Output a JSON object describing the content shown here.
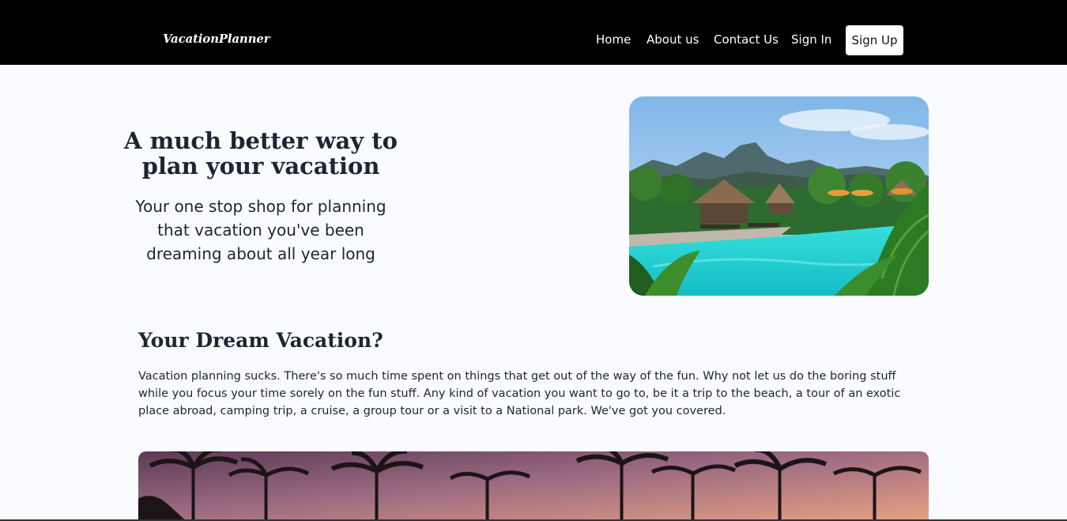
{
  "nav": {
    "brand": "VacationPlanner",
    "links": [
      "Home",
      "About us",
      "Contact Us",
      "Sign In"
    ],
    "signup_label": "Sign Up"
  },
  "hero": {
    "title": "A much better way to plan your vacation",
    "subtitle": "Your one stop shop for planning that vacation you've been dreaming about all year long",
    "image": "tropical-resort-pool-photo"
  },
  "dream": {
    "heading": "Your Dream Vacation?",
    "body": "Vacation planning sucks. There's so much time spent on things that get out of the way of the fun. Why not let us do the boring stuff while you focus your time sorely on the fun stuff. Any kind of vacation you want to go to, be it a trip to the beach, a tour of an exotic place abroad, camping trip, a cruise, a group tour or a visit to a National park. We've got you covered.",
    "image": "palm-trees-sunset-photo"
  },
  "colors": {
    "nav_bg": "#000000",
    "page_bg": "#fafbff",
    "text": "#1f2433",
    "pool": "#2ad4d4"
  }
}
